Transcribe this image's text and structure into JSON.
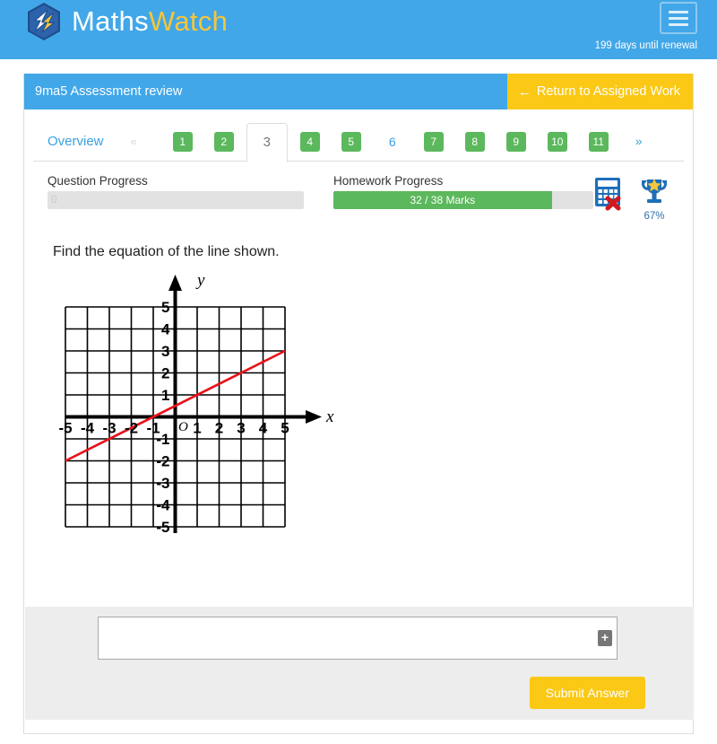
{
  "header": {
    "logo_text_primary": "Maths",
    "logo_text_secondary": "Watch",
    "logo_icon": "mathswatch-hexagon-logo",
    "menu_icon": "hamburger-menu-icon",
    "renewal_notice": "199 days until renewal",
    "brand_blue": "#41a7e8",
    "brand_yellow": "#f5c63c"
  },
  "card": {
    "title": "9ma5 Assessment review",
    "return_label": "Return to Assigned Work",
    "return_arrow": "←",
    "return_color": "#fac815"
  },
  "tabs": {
    "overview_label": "Overview",
    "prev_label": "«",
    "next_label": "»",
    "items": [
      {
        "label": "1",
        "state": "done"
      },
      {
        "label": "2",
        "state": "done"
      },
      {
        "label": "3",
        "state": "active"
      },
      {
        "label": "4",
        "state": "done"
      },
      {
        "label": "5",
        "state": "done"
      },
      {
        "label": "6",
        "state": "plain"
      },
      {
        "label": "7",
        "state": "done"
      },
      {
        "label": "8",
        "state": "done"
      },
      {
        "label": "9",
        "state": "done"
      },
      {
        "label": "10",
        "state": "done"
      },
      {
        "label": "11",
        "state": "done"
      }
    ],
    "done_color": "#5cb85c",
    "link_color": "#3aa0e0"
  },
  "progress": {
    "question": {
      "label": "Question Progress",
      "value_text": "0",
      "percent": 0
    },
    "homework": {
      "label": "Homework Progress",
      "value_text": "32 / 38 Marks",
      "marks_earned": 32,
      "marks_total": 38,
      "percent": 84
    },
    "calculator_icon": "calculator-not-allowed-icon",
    "trophy_icon": "trophy-star-icon",
    "trophy_percent": "67%"
  },
  "question": {
    "prompt": "Find the equation of the line shown.",
    "axis_label_x": "x",
    "axis_label_y": "y",
    "origin_label": "O"
  },
  "chart_data": {
    "type": "line",
    "title": "",
    "xlabel": "x",
    "ylabel": "y",
    "xlim": [
      -5,
      5
    ],
    "ylim": [
      -5,
      5
    ],
    "xticks": [
      -5,
      -4,
      -3,
      -2,
      -1,
      1,
      2,
      3,
      4,
      5
    ],
    "yticks": [
      5,
      4,
      3,
      2,
      1,
      -1,
      -2,
      -3,
      -4,
      -5
    ],
    "grid": true,
    "grid_color": "#000000",
    "line_color": "#e8131a",
    "series": [
      {
        "name": "line",
        "equation": "y = 0.5x + 0.5",
        "slope": 0.5,
        "intercept": 0.5,
        "points": [
          [
            -5,
            -2
          ],
          [
            5,
            3
          ]
        ]
      }
    ]
  },
  "answer": {
    "value": "",
    "placeholder": "",
    "insert_symbol_label": "+",
    "submit_label": "Submit Answer"
  }
}
